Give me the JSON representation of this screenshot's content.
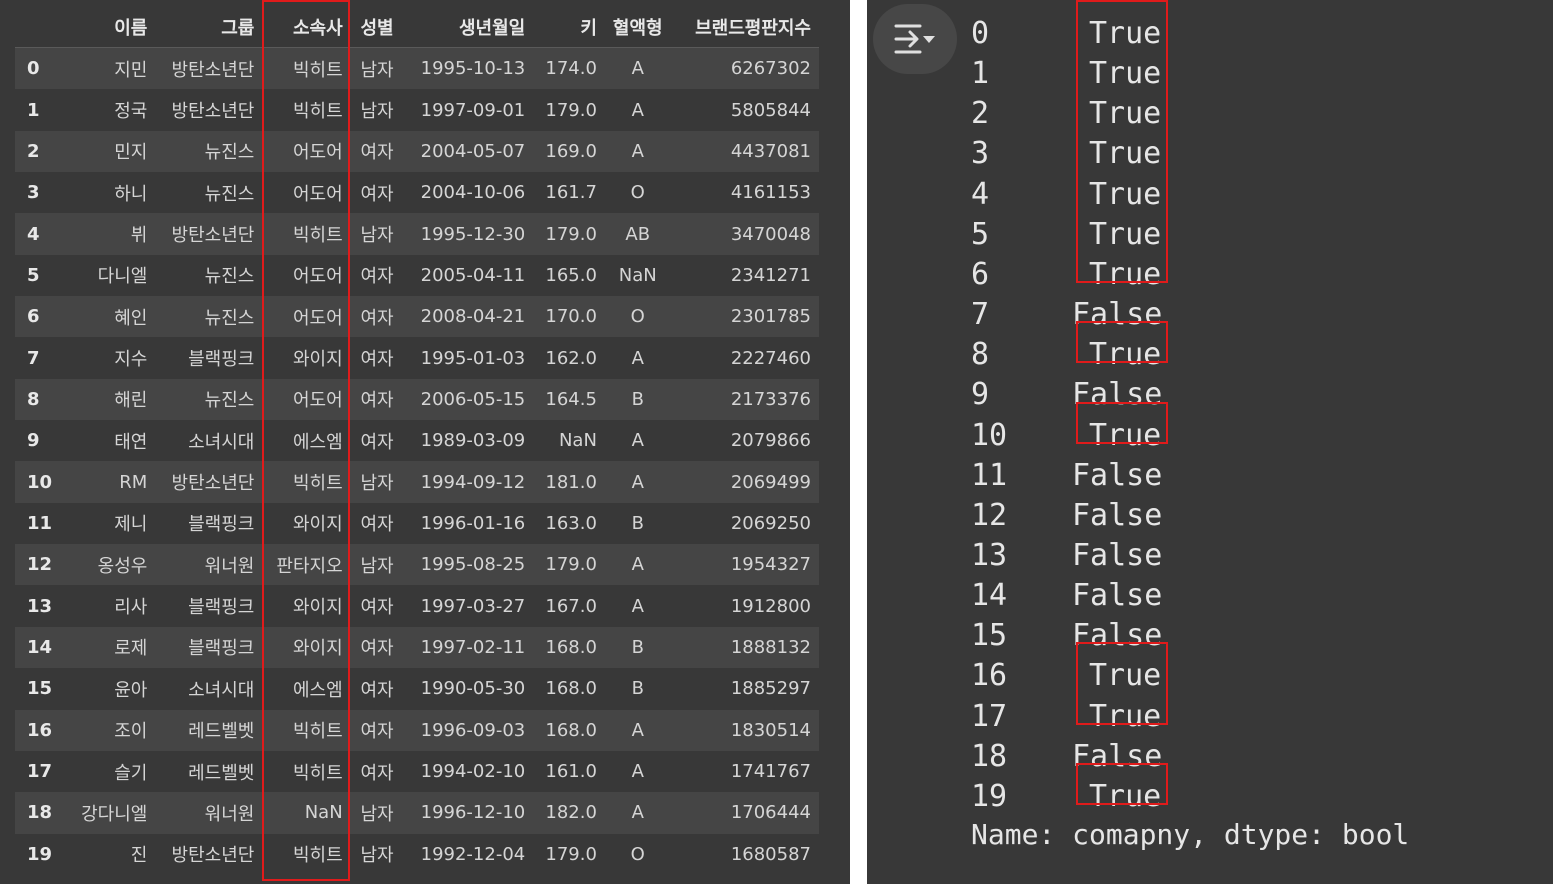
{
  "dataframe": {
    "columns": [
      "",
      "이름",
      "그룹",
      "소속사",
      "성별",
      "생년월일",
      "키",
      "혈액형",
      "브랜드평판지수"
    ],
    "rows": [
      [
        "0",
        "지민",
        "방탄소년단",
        "빅히트",
        "남자",
        "1995-10-13",
        "174.0",
        "A",
        "6267302"
      ],
      [
        "1",
        "정국",
        "방탄소년단",
        "빅히트",
        "남자",
        "1997-09-01",
        "179.0",
        "A",
        "5805844"
      ],
      [
        "2",
        "민지",
        "뉴진스",
        "어도어",
        "여자",
        "2004-05-07",
        "169.0",
        "A",
        "4437081"
      ],
      [
        "3",
        "하니",
        "뉴진스",
        "어도어",
        "여자",
        "2004-10-06",
        "161.7",
        "O",
        "4161153"
      ],
      [
        "4",
        "뷔",
        "방탄소년단",
        "빅히트",
        "남자",
        "1995-12-30",
        "179.0",
        "AB",
        "3470048"
      ],
      [
        "5",
        "다니엘",
        "뉴진스",
        "어도어",
        "여자",
        "2005-04-11",
        "165.0",
        "NaN",
        "2341271"
      ],
      [
        "6",
        "혜인",
        "뉴진스",
        "어도어",
        "여자",
        "2008-04-21",
        "170.0",
        "O",
        "2301785"
      ],
      [
        "7",
        "지수",
        "블랙핑크",
        "와이지",
        "여자",
        "1995-01-03",
        "162.0",
        "A",
        "2227460"
      ],
      [
        "8",
        "해린",
        "뉴진스",
        "어도어",
        "여자",
        "2006-05-15",
        "164.5",
        "B",
        "2173376"
      ],
      [
        "9",
        "태연",
        "소녀시대",
        "에스엠",
        "여자",
        "1989-03-09",
        "NaN",
        "A",
        "2079866"
      ],
      [
        "10",
        "RM",
        "방탄소년단",
        "빅히트",
        "남자",
        "1994-09-12",
        "181.0",
        "A",
        "2069499"
      ],
      [
        "11",
        "제니",
        "블랙핑크",
        "와이지",
        "여자",
        "1996-01-16",
        "163.0",
        "B",
        "2069250"
      ],
      [
        "12",
        "옹성우",
        "워너원",
        "판타지오",
        "남자",
        "1995-08-25",
        "179.0",
        "A",
        "1954327"
      ],
      [
        "13",
        "리사",
        "블랙핑크",
        "와이지",
        "여자",
        "1997-03-27",
        "167.0",
        "A",
        "1912800"
      ],
      [
        "14",
        "로제",
        "블랙핑크",
        "와이지",
        "여자",
        "1997-02-11",
        "168.0",
        "B",
        "1888132"
      ],
      [
        "15",
        "윤아",
        "소녀시대",
        "에스엠",
        "여자",
        "1990-05-30",
        "168.0",
        "B",
        "1885297"
      ],
      [
        "16",
        "조이",
        "레드벨벳",
        "빅히트",
        "여자",
        "1996-09-03",
        "168.0",
        "A",
        "1830514"
      ],
      [
        "17",
        "슬기",
        "레드벨벳",
        "빅히트",
        "여자",
        "1994-02-10",
        "161.0",
        "A",
        "1741767"
      ],
      [
        "18",
        "강다니엘",
        "워너원",
        "NaN",
        "남자",
        "1996-12-10",
        "182.0",
        "A",
        "1706444"
      ],
      [
        "19",
        "진",
        "방탄소년단",
        "빅히트",
        "남자",
        "1992-12-04",
        "179.0",
        "O",
        "1680587"
      ]
    ]
  },
  "output_button": {
    "icon": "output-format-icon"
  },
  "series": {
    "items": [
      {
        "index": "0",
        "value": "True"
      },
      {
        "index": "1",
        "value": "True"
      },
      {
        "index": "2",
        "value": "True"
      },
      {
        "index": "3",
        "value": "True"
      },
      {
        "index": "4",
        "value": "True"
      },
      {
        "index": "5",
        "value": "True"
      },
      {
        "index": "6",
        "value": "True"
      },
      {
        "index": "7",
        "value": "False"
      },
      {
        "index": "8",
        "value": "True"
      },
      {
        "index": "9",
        "value": "False"
      },
      {
        "index": "10",
        "value": "True"
      },
      {
        "index": "11",
        "value": "False"
      },
      {
        "index": "12",
        "value": "False"
      },
      {
        "index": "13",
        "value": "False"
      },
      {
        "index": "14",
        "value": "False"
      },
      {
        "index": "15",
        "value": "False"
      },
      {
        "index": "16",
        "value": "True"
      },
      {
        "index": "17",
        "value": "True"
      },
      {
        "index": "18",
        "value": "False"
      },
      {
        "index": "19",
        "value": "True"
      }
    ],
    "footer": "Name: comapny, dtype: bool"
  },
  "colors": {
    "panel_bg": "#383838",
    "row_alt": "#454545",
    "highlight": "#e01b1b"
  }
}
